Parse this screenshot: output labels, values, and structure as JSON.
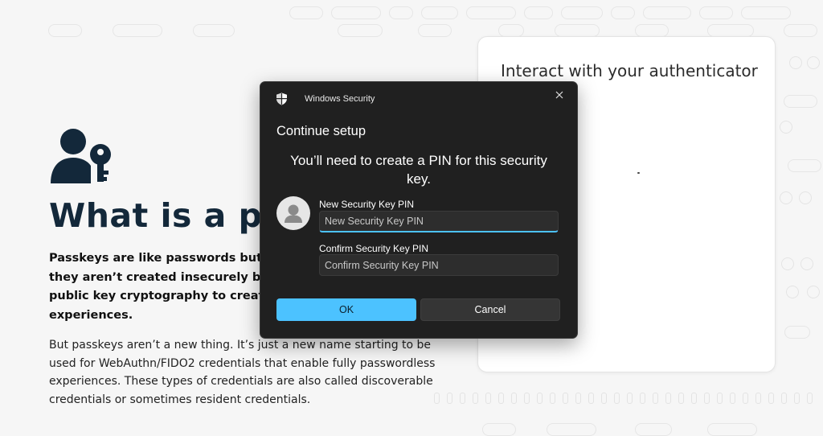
{
  "article": {
    "title": "What is a pas",
    "lead_lines": [
      "Passkeys are like passwords but bette",
      "they aren’t created insecurely by hum",
      "public key cryptography to create mu",
      "experiences."
    ],
    "body_lines": [
      "But passkeys aren’t a new thing. It’s just a new name starting to be",
      "used for WebAuthn/FIDO2 credentials that enable fully passwordless",
      "experiences. These types of credentials are also called discoverable",
      "credentials or sometimes resident credentials."
    ],
    "icon": "user-key-icon"
  },
  "card": {
    "title": "Interact with your authenticator"
  },
  "dialog": {
    "app_name": "Windows Security",
    "heading": "Continue setup",
    "message": "You’ll need to create a PIN for this security key.",
    "pin_label": "New Security Key PIN",
    "pin_placeholder": "New Security Key PIN",
    "confirm_label": "Confirm Security Key PIN",
    "confirm_placeholder": "Confirm Security Key PIN",
    "ok_label": "OK",
    "cancel_label": "Cancel",
    "accent_color": "#4cc2ff"
  }
}
